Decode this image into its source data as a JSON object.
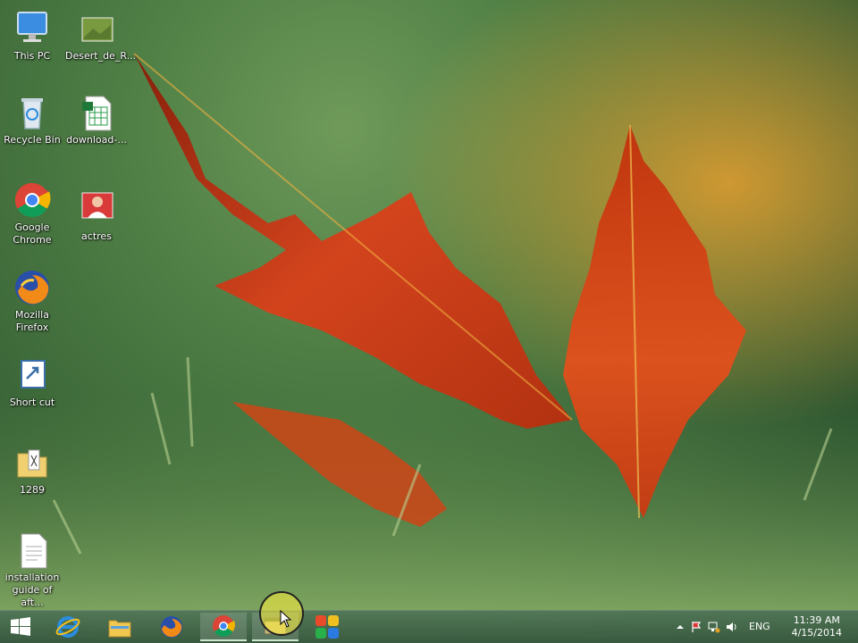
{
  "desktop": {
    "icons": [
      {
        "label": "This PC",
        "icon": "computer-icon"
      },
      {
        "label": "Desert_de_R...",
        "icon": "image-file-icon"
      },
      {
        "label": "Recycle Bin",
        "icon": "recycle-bin-icon"
      },
      {
        "label": "download-...",
        "icon": "spreadsheet-file-icon"
      },
      {
        "label": "Google\nChrome",
        "icon": "chrome-icon"
      },
      {
        "label": "actres",
        "icon": "photo-file-icon"
      },
      {
        "label": "Mozilla\nFirefox",
        "icon": "firefox-icon"
      },
      {
        "label": "Short cut",
        "icon": "shortcut-icon"
      },
      {
        "label": "1289",
        "icon": "folder-icon"
      },
      {
        "label": "installation\nguide of aft...",
        "icon": "document-icon"
      }
    ]
  },
  "taskbar": {
    "pinned": [
      {
        "name": "start",
        "icon": "windows-logo-icon"
      },
      {
        "name": "internet-explorer",
        "icon": "internet-explorer-icon"
      },
      {
        "name": "file-explorer",
        "icon": "file-explorer-icon"
      },
      {
        "name": "firefox",
        "icon": "firefox-icon"
      },
      {
        "name": "chrome",
        "icon": "chrome-icon"
      },
      {
        "name": "app-window",
        "icon": "app-window-icon"
      },
      {
        "name": "tile-app",
        "icon": "tile-app-icon"
      }
    ],
    "tray": {
      "language": "ENG",
      "time": "11:39 AM",
      "date": "4/15/2014"
    }
  }
}
